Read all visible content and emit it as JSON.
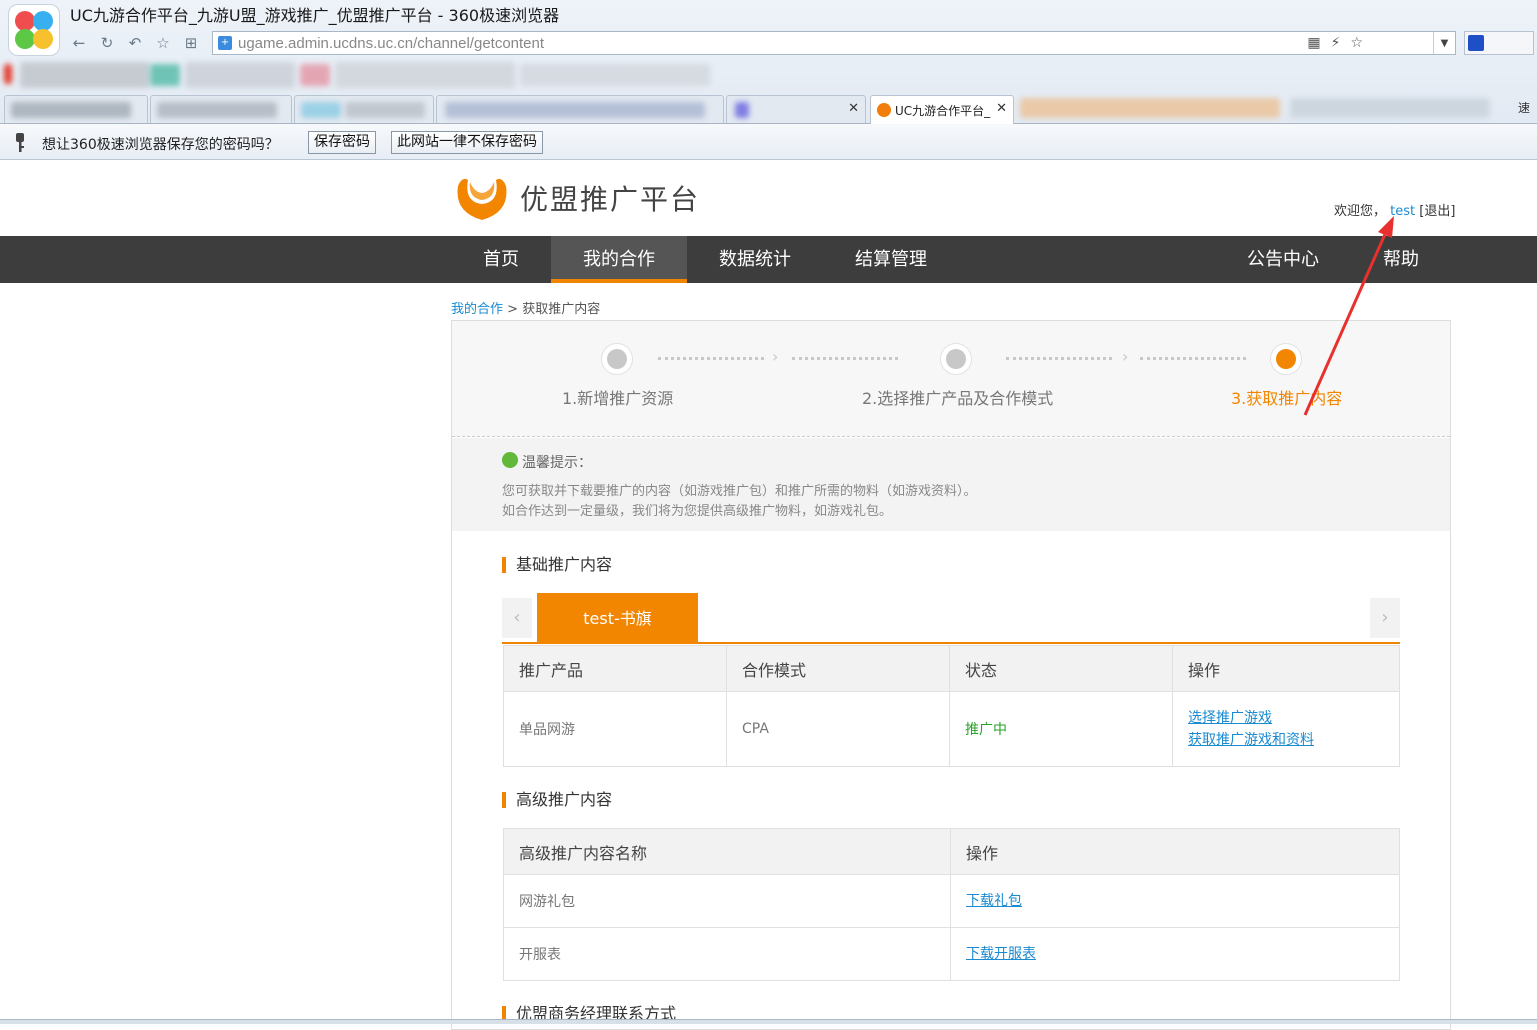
{
  "browser": {
    "window_title": "UC九游合作平台_九游U盟_游戏推广_优盟推广平台  - 360极速浏览器",
    "url": "ugame.admin.ucdns.uc.cn/channel/getcontent",
    "tab_title": "UC九游合作平台_",
    "password_prompt": "想让360极速浏览器保存您的密码吗？",
    "save_password_label": "保存密码",
    "never_save_label": "此网站一律不保存密码",
    "right_edge_char": "速"
  },
  "site": {
    "brand_name": "优盟推广平台",
    "welcome_text": "欢迎您，",
    "username": "test",
    "logout_label": "[退出]"
  },
  "nav": {
    "items": [
      "首页",
      "我的合作",
      "数据统计",
      "结算管理",
      "公告中心",
      "帮助"
    ],
    "active": "我的合作"
  },
  "breadcrumb": {
    "parent": "我的合作",
    "separator": " > ",
    "current": "获取推广内容"
  },
  "steps": [
    {
      "label": "1.新增推广资源",
      "state": "done"
    },
    {
      "label": "2.选择推广产品及合作模式",
      "state": "done"
    },
    {
      "label": "3.获取推广内容",
      "state": "current"
    }
  ],
  "tip": {
    "title": "温馨提示：",
    "line1": "您可获取并下载要推广的内容（如游戏推广包）和推广所需的物料（如游戏资料）。",
    "line2": "如合作达到一定量级，我们将为您提供高级推广物料，如游戏礼包。"
  },
  "basic_section": {
    "title": "基础推广内容",
    "product_tab": "test-书旗",
    "prev_arrow": "‹",
    "next_arrow": "›",
    "headers": [
      "推广产品",
      "合作模式",
      "状态",
      "操作"
    ],
    "row": {
      "product": "单品网游",
      "mode": "CPA",
      "status": "推广中",
      "action1": "选择推广游戏",
      "action2": "获取推广游戏和资料"
    }
  },
  "advanced_section": {
    "title": "高级推广内容",
    "headers": [
      "高级推广内容名称",
      "操作"
    ],
    "rows": [
      {
        "name": "网游礼包",
        "action": "下载礼包"
      },
      {
        "name": "开服表",
        "action": "下载开服表"
      }
    ]
  },
  "contact_section": {
    "title": "优盟商务经理联系方式"
  },
  "colors": {
    "accent": "#f28600",
    "nav_bg": "#3d3d3d",
    "link": "#1a8ad1",
    "status_green": "#2aa12a",
    "annotation_arrow": "#e8302e"
  }
}
